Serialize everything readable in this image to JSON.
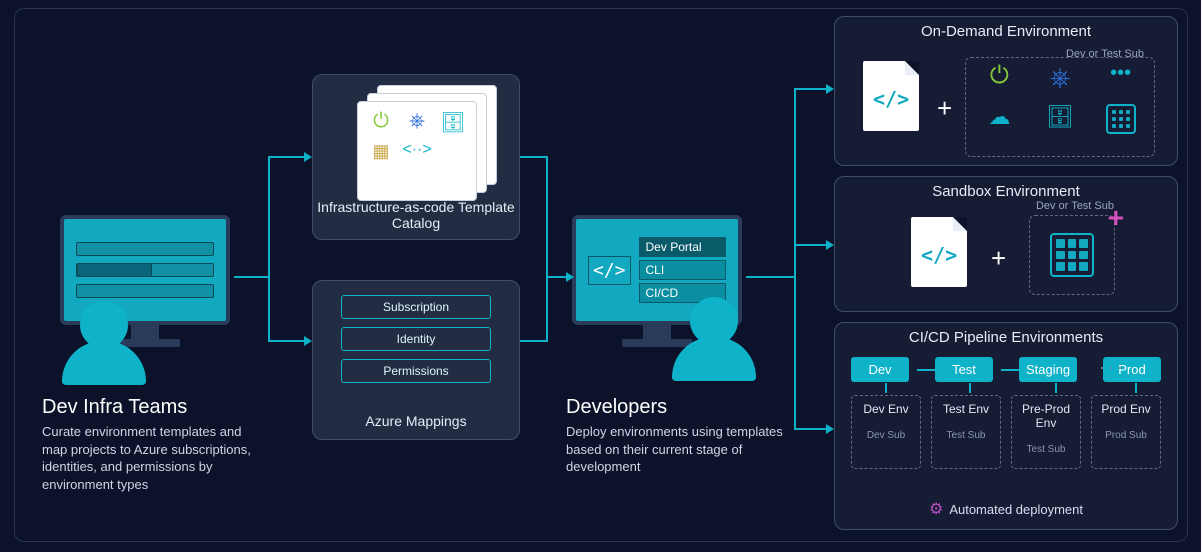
{
  "leftPersona": {
    "title": "Dev Infra Teams",
    "desc": "Curate environment templates and map projects to Azure subscriptions, identities, and permissions by environment types"
  },
  "iacBox": {
    "caption": "Infrastructure-as-code Template Catalog"
  },
  "mappingsBox": {
    "rows": [
      "Subscription",
      "Identity",
      "Permissions"
    ],
    "caption": "Azure Mappings"
  },
  "devPersona": {
    "title": "Developers",
    "desc": "Deploy environments using templates based on their current stage of development",
    "list": [
      "Dev Portal",
      "CLI",
      "CI/CD"
    ]
  },
  "envOnDemand": {
    "title": "On-Demand Environment",
    "subBadge": "Dev or Test Sub"
  },
  "envSandbox": {
    "title": "Sandbox Environment",
    "subBadge": "Dev or Test Sub"
  },
  "pipeline": {
    "title": "CI/CD Pipeline Environments",
    "stages": [
      "Dev",
      "Test",
      "Staging",
      "Prod"
    ],
    "envs": [
      {
        "name": "Dev Env",
        "sub": "Dev Sub"
      },
      {
        "name": "Test Env",
        "sub": "Test Sub"
      },
      {
        "name": "Pre-Prod Env",
        "sub": "Test Sub"
      },
      {
        "name": "Prod Env",
        "sub": "Prod Sub"
      }
    ],
    "automated": "Automated deployment"
  }
}
